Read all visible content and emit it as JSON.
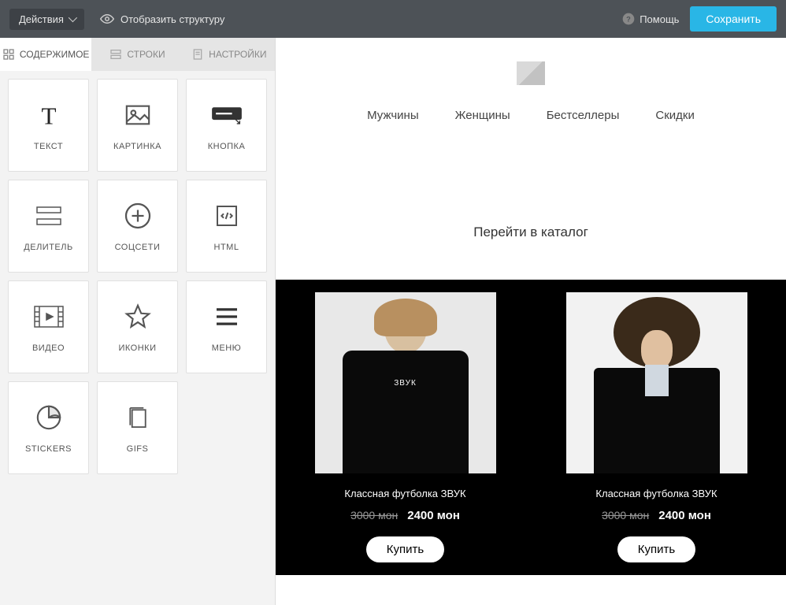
{
  "topbar": {
    "actions_label": "Действия",
    "structure_label": "Отобразить структуру",
    "help_label": "Помощь",
    "save_label": "Сохранить"
  },
  "tabs": {
    "content": "СОДЕРЖИМОЕ",
    "rows": "СТРОКИ",
    "settings": "НАСТРОЙКИ"
  },
  "blocks": [
    {
      "id": "text",
      "label": "ТЕКСТ"
    },
    {
      "id": "image",
      "label": "КАРТИНКА"
    },
    {
      "id": "button",
      "label": "КНОПКА"
    },
    {
      "id": "divider",
      "label": "ДЕЛИТЕЛЬ"
    },
    {
      "id": "social",
      "label": "СОЦСЕТИ"
    },
    {
      "id": "html",
      "label": "HTML"
    },
    {
      "id": "video",
      "label": "ВИДЕО"
    },
    {
      "id": "icons",
      "label": "ИКОНКИ"
    },
    {
      "id": "menu",
      "label": "МЕНЮ"
    },
    {
      "id": "stickers",
      "label": "STICKERS"
    },
    {
      "id": "gifs",
      "label": "GIFS"
    }
  ],
  "preview": {
    "nav": {
      "men": "Мужчины",
      "women": "Женщины",
      "bestsellers": "Бестселлеры",
      "sale": "Скидки"
    },
    "catalog_link": "Перейти в каталог",
    "products": [
      {
        "title": "Классная футболка ЗВУК",
        "old_price": "3000 мон",
        "price": "2400 мон",
        "buy": "Купить"
      },
      {
        "title": "Классная футболка ЗВУК",
        "old_price": "3000 мон",
        "price": "2400 мон",
        "buy": "Купить"
      }
    ]
  }
}
